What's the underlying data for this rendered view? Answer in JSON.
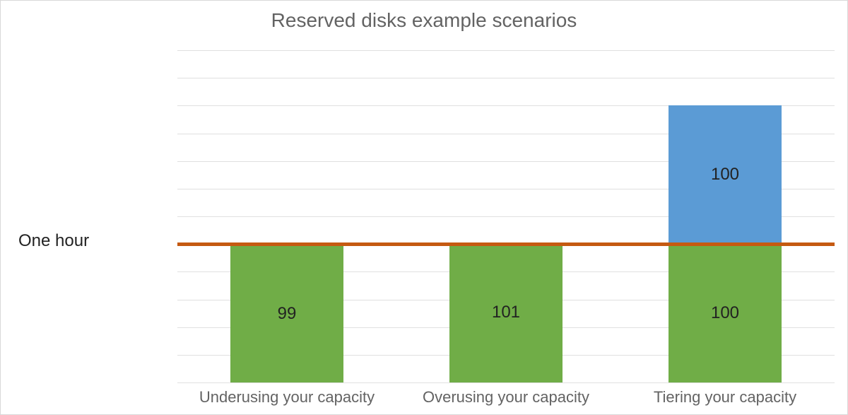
{
  "chart_data": {
    "type": "bar",
    "title": "Reserved disks example scenarios",
    "categories": [
      "Underusing your capacity",
      "Overusing your capacity",
      "Tiering your capacity"
    ],
    "series": [
      {
        "name": "green",
        "values": [
          99,
          101,
          100
        ],
        "color": "#70ad47"
      },
      {
        "name": "blue",
        "values": [
          0,
          0,
          100
        ],
        "color": "#5b9bd5"
      }
    ],
    "stacked": true,
    "reference_line": {
      "label": "One hour",
      "value": 100,
      "color": "#c55a11"
    },
    "ylim": [
      0,
      240
    ],
    "grid_step": 20,
    "xlabel": "",
    "ylabel": ""
  }
}
